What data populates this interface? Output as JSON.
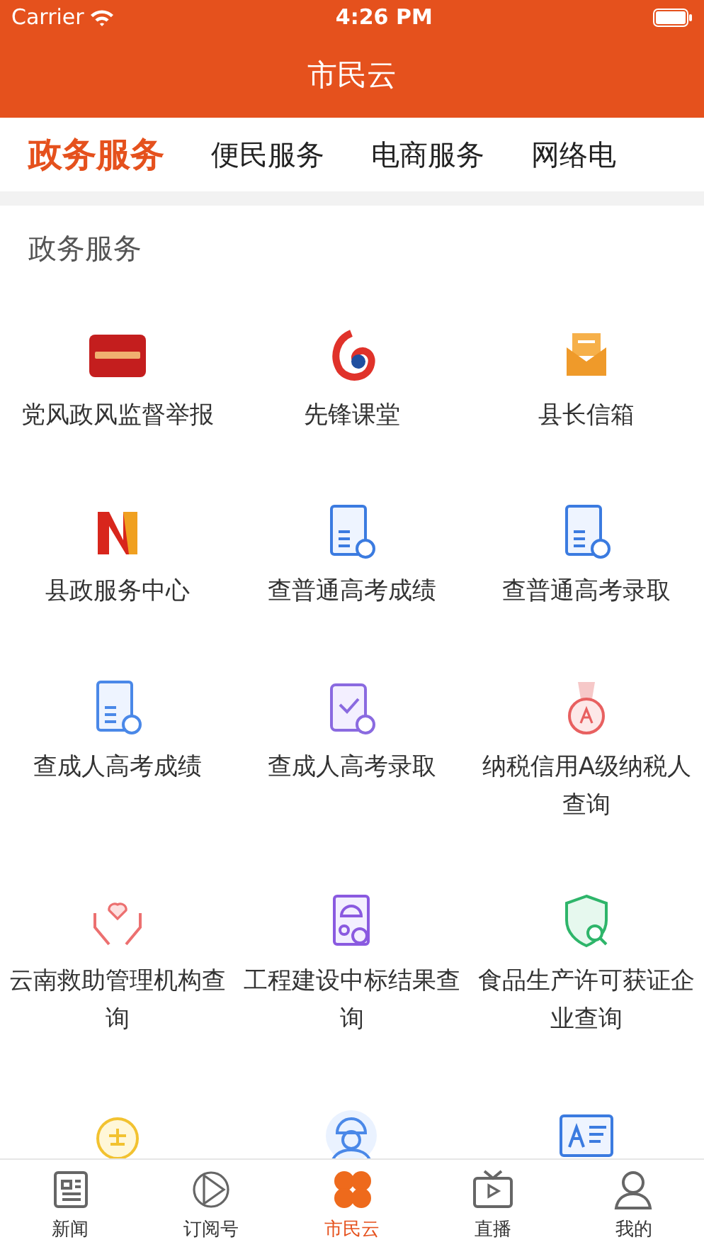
{
  "status_bar": {
    "carrier": "Carrier",
    "time": "4:26 PM"
  },
  "header": {
    "title": "市民云"
  },
  "tabs": [
    {
      "label": "政务服务",
      "selected": true
    },
    {
      "label": "便民服务",
      "selected": false
    },
    {
      "label": "电商服务",
      "selected": false
    },
    {
      "label": "网络电",
      "selected": false
    }
  ],
  "section": {
    "title": "政务服务",
    "items": [
      {
        "label": "党风政风监督举报"
      },
      {
        "label": "先锋课堂"
      },
      {
        "label": "县长信箱"
      },
      {
        "label": "县政服务中心"
      },
      {
        "label": "查普通高考成绩"
      },
      {
        "label": "查普通高考录取"
      },
      {
        "label": "查成人高考成绩"
      },
      {
        "label": "查成人高考录取"
      },
      {
        "label": "纳税信用A级纳税人查询"
      },
      {
        "label": "云南救助管理机构查询"
      },
      {
        "label": "工程建设中标结果查询"
      },
      {
        "label": "食品生产许可获证企业查询"
      },
      {
        "kind": "partial"
      },
      {
        "kind": "partial"
      },
      {
        "kind": "partial"
      }
    ]
  },
  "bottom_nav": [
    {
      "label": "新闻",
      "selected": false
    },
    {
      "label": "订阅号",
      "selected": false
    },
    {
      "label": "市民云",
      "selected": true
    },
    {
      "label": "直播",
      "selected": false
    },
    {
      "label": "我的",
      "selected": false
    }
  ]
}
